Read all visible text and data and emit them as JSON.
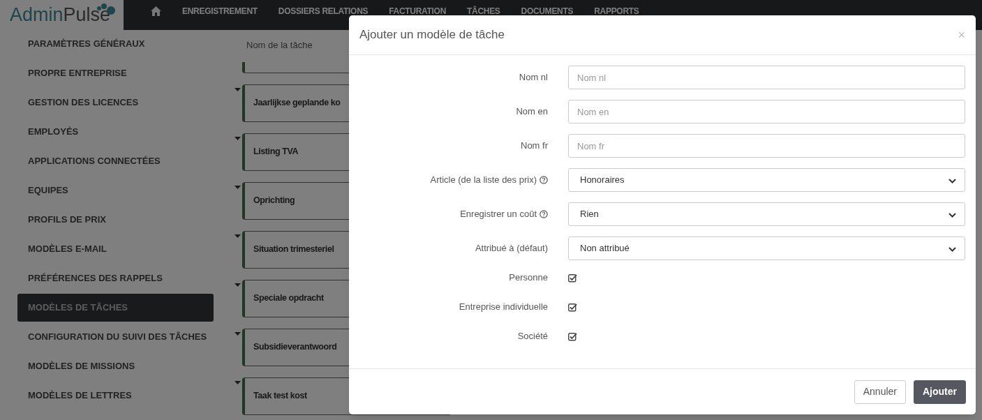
{
  "navbar": {
    "logo_parts": [
      "Admin",
      "Pulse"
    ],
    "items": [
      {
        "label": "ENREGISTREMENT"
      },
      {
        "label": "DOSSIERS RELATIONS"
      },
      {
        "label": "FACTURATION"
      },
      {
        "label": "TÂCHES"
      },
      {
        "label": "DOCUMENTS"
      },
      {
        "label": "RAPPORTS"
      }
    ]
  },
  "sidebar": {
    "items": [
      {
        "label": "PARAMÈTRES GÉNÉRAUX",
        "selected": false
      },
      {
        "label": "PROPRE ENTREPRISE",
        "selected": false
      },
      {
        "label": "GESTION DES LICENCES",
        "selected": false
      },
      {
        "label": "EMPLOYÉS",
        "selected": false
      },
      {
        "label": "APPLICATIONS CONNECTÉES",
        "selected": false
      },
      {
        "label": "EQUIPES",
        "selected": false
      },
      {
        "label": "PROFILS DE PRIX",
        "selected": false
      },
      {
        "label": "MODÈLES E-MAIL",
        "selected": false
      },
      {
        "label": "PRÉFÉRENCES DES RAPPELS",
        "selected": false
      },
      {
        "label": "MODÈLES DE TÂCHES",
        "selected": true
      },
      {
        "label": "CONFIGURATION DU SUIVI DES TÂCHES",
        "selected": false
      },
      {
        "label": "MODÈLES DE MISSIONS",
        "selected": false
      },
      {
        "label": "MODÈLES DE LETTRES",
        "selected": false
      }
    ]
  },
  "task_list": {
    "column_header": "Nom de la tâche",
    "tasks": [
      {
        "name": "Jaarlijkse geplande ko"
      },
      {
        "name": "Listing TVA"
      },
      {
        "name": "Oprichting"
      },
      {
        "name": "Situation trimesteriel"
      },
      {
        "name": "Speciale opdracht"
      },
      {
        "name": "Subsidieverantwoord"
      },
      {
        "name": "Taak test kost"
      }
    ]
  },
  "modal": {
    "title": "Ajouter un modèle de tâche",
    "close": "×",
    "fields": [
      {
        "kind": "text",
        "label": "Nom nl",
        "placeholder": "Nom nl"
      },
      {
        "kind": "text",
        "label": "Nom en",
        "placeholder": "Nom en"
      },
      {
        "kind": "text",
        "label": "Nom fr",
        "placeholder": "Nom fr"
      },
      {
        "kind": "select",
        "label": "Article (de la liste des prix)",
        "help": true,
        "value": "Honoraires"
      },
      {
        "kind": "select",
        "label": "Enregistrer un coût",
        "help": true,
        "value": "Rien"
      },
      {
        "kind": "select",
        "label": "Attribué à (défaut)",
        "help": false,
        "value": "Non attribué"
      },
      {
        "kind": "checkbox",
        "label": "Personne",
        "checked": true
      },
      {
        "kind": "checkbox",
        "label": "Entreprise individuelle",
        "checked": true
      },
      {
        "kind": "checkbox",
        "label": "Société",
        "checked": true
      }
    ],
    "buttons": [
      {
        "label": "Annuler",
        "kind": "secondary"
      },
      {
        "label": "Ajouter",
        "kind": "primary"
      }
    ]
  }
}
